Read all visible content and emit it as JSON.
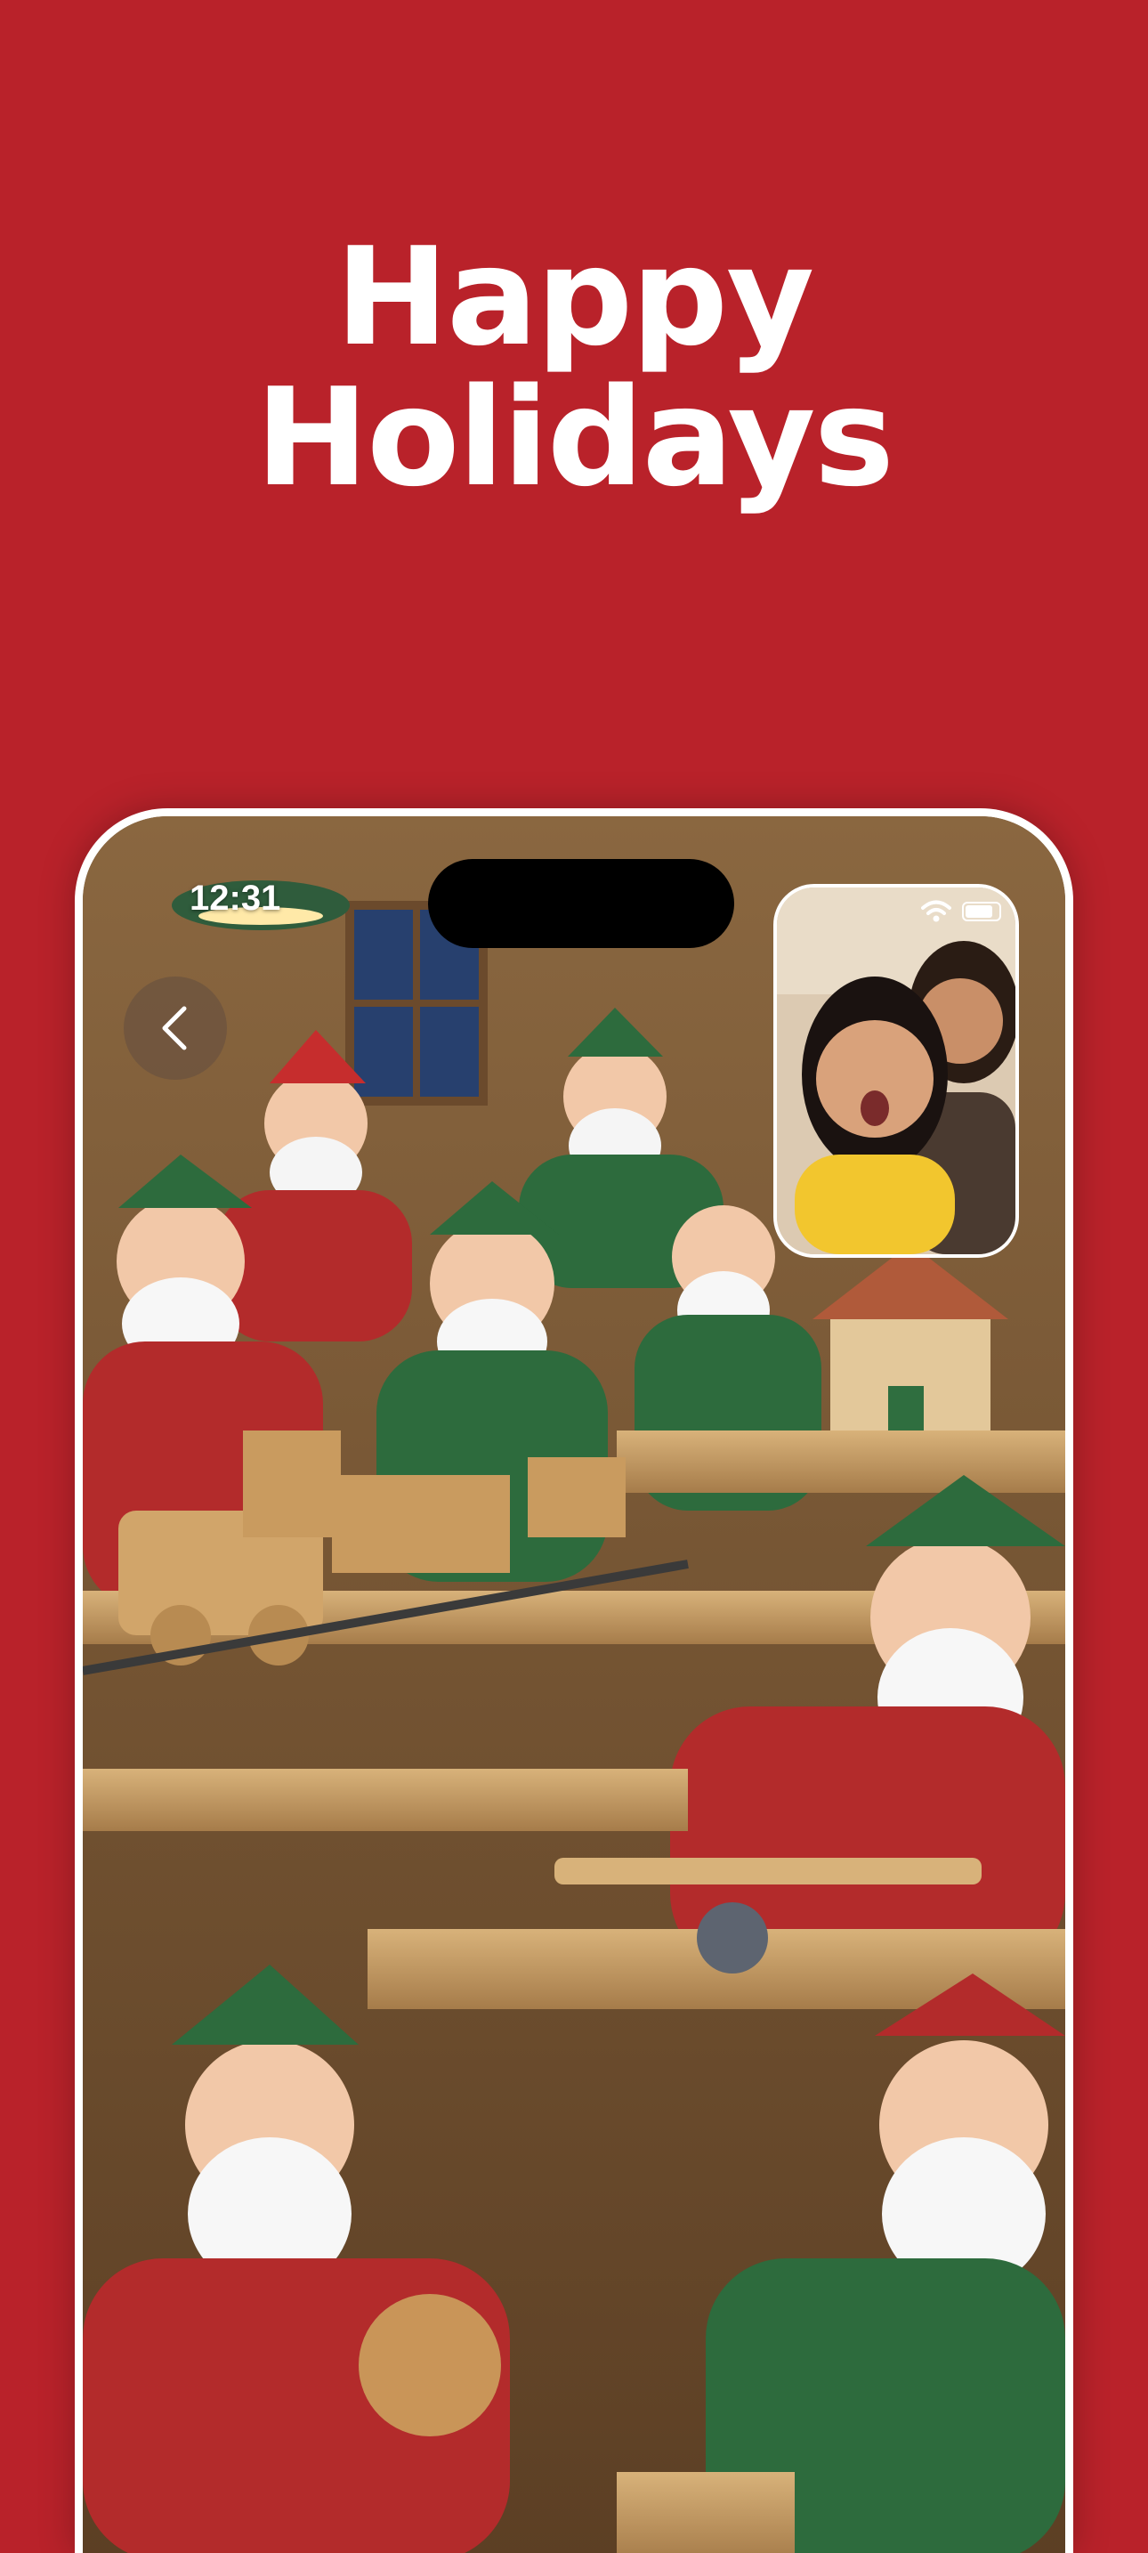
{
  "headline": {
    "line1": "Happy",
    "line2": "Holidays"
  },
  "phone": {
    "status_time": "12:31",
    "back_icon": "chevron-left-icon",
    "pip_status_icons": [
      "wifi-icon",
      "battery-icon"
    ]
  },
  "colors": {
    "background": "#b9222a",
    "headline_text": "#ffffff",
    "phone_border": "#ffffff"
  }
}
